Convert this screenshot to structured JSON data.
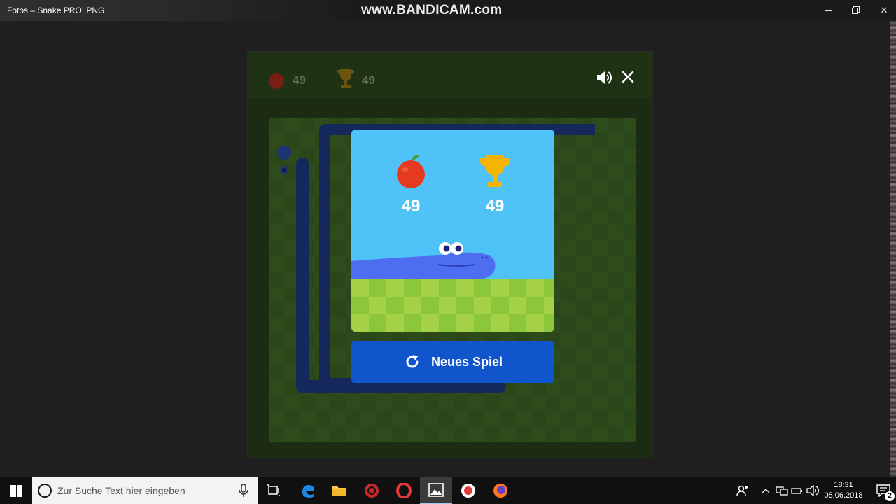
{
  "window": {
    "title": "Fotos – Snake PRO!.PNG",
    "watermark": "www.BANDICAM.com"
  },
  "game": {
    "score": "49",
    "best": "49",
    "new_game_label": "Neues Spiel",
    "colors": {
      "sky": "#4fc3f7",
      "grass": "#a5d146",
      "snake": "#4e6ef2",
      "button": "#1155cc",
      "apple": "#e53a1f",
      "trophy": "#f4b400"
    }
  },
  "taskbar": {
    "search_placeholder": "Zur Suche Text hier eingeben",
    "apps": [
      "task-view",
      "edge",
      "file-explorer",
      "app-red",
      "opera",
      "photos",
      "bandicam",
      "firefox"
    ],
    "time": "18:31",
    "date": "05.06.2018",
    "notification_count": "2"
  }
}
